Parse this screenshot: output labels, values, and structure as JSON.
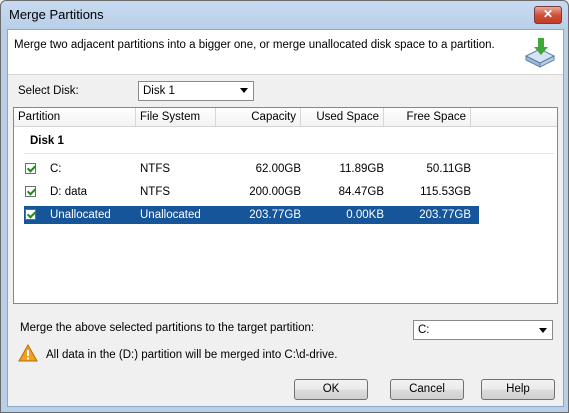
{
  "window": {
    "title": "Merge Partitions",
    "close_glyph": "✕"
  },
  "header": {
    "description": "Merge two adjacent partitions into a bigger one, or merge unallocated disk space to a partition."
  },
  "select_disk": {
    "label": "Select Disk:",
    "value": "Disk 1"
  },
  "table": {
    "columns": [
      "Partition",
      "File System",
      "Capacity",
      "Used Space",
      "Free Space"
    ],
    "group": "Disk 1",
    "rows": [
      {
        "checked": true,
        "partition": "C:",
        "fs": "NTFS",
        "capacity": "62.00GB",
        "used": "11.89GB",
        "free": "50.11GB",
        "selected": false
      },
      {
        "checked": true,
        "partition": "D:  data",
        "fs": "NTFS",
        "capacity": "200.00GB",
        "used": "84.47GB",
        "free": "115.53GB",
        "selected": false
      },
      {
        "checked": true,
        "partition": "Unallocated",
        "fs": "Unallocated",
        "capacity": "203.77GB",
        "used": "0.00KB",
        "free": "203.77GB",
        "selected": true
      }
    ]
  },
  "merge": {
    "label": "Merge the above selected partitions to the target partition:",
    "target_value": "C:",
    "warning": "All data in the (D:) partition will be merged into C:\\d-drive."
  },
  "buttons": {
    "ok": "OK",
    "cancel": "Cancel",
    "help": "Help"
  },
  "colors": {
    "selection": "#16559a",
    "check": "#1d8a1d",
    "warning": "#f0a020"
  }
}
